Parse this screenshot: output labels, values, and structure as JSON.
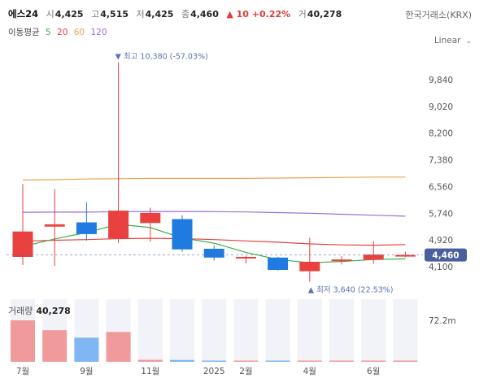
{
  "header": {
    "name": "에스24",
    "open_label": "시",
    "open": "4,425",
    "high_label": "고",
    "high": "4,515",
    "low_label": "저",
    "low": "4,425",
    "close_label": "종",
    "close": "4,460",
    "change": "▲ 10 +0.22%",
    "vol_label": "거",
    "vol": "40,278",
    "exchange": "한국거래소(KRX)",
    "scale_mode": "Linear"
  },
  "ma": {
    "label": "이동평균",
    "ma5": "5",
    "ma20": "20",
    "ma60": "60",
    "ma120": "120"
  },
  "volume_header": {
    "label": "거래량",
    "value": "40,278"
  },
  "colors": {
    "up": "#e8413f",
    "down": "#1f7be0",
    "vol_up": "#f19a9b",
    "vol_down": "#7fb6f3",
    "ma5": "#3fae4a",
    "ma20": "#e8413f",
    "ma60": "#f0a150",
    "ma120": "#9b6ad8",
    "current_badge": "#4a5f9e",
    "annot": "#5a74b3"
  },
  "chart_data": {
    "type": "candlestick",
    "x_tick_labels": [
      "7월",
      "9월",
      "11월",
      "2025",
      "2월",
      "4월",
      "6월"
    ],
    "y_ticks": [
      4100,
      4920,
      5740,
      6560,
      7380,
      8200,
      9020,
      9840
    ],
    "y_tick_labels": [
      "4,100",
      "4,920",
      "5,740",
      "6,560",
      "7,380",
      "8,200",
      "9,020",
      "9,840"
    ],
    "ylim": [
      3500,
      11000
    ],
    "current_price": 4460,
    "current_price_label": "4,460",
    "annotations": {
      "high": "최고 10,380 (-57.03%)",
      "low": "최저 3,640 (22.53%)"
    },
    "candles": [
      {
        "o": 4400,
        "h": 6640,
        "l": 4150,
        "c": 5180
      },
      {
        "o": 5330,
        "h": 6490,
        "l": 4120,
        "c": 5400
      },
      {
        "o": 5460,
        "h": 6080,
        "l": 4900,
        "c": 5100
      },
      {
        "o": 4970,
        "h": 10380,
        "l": 4820,
        "c": 5820
      },
      {
        "o": 5440,
        "h": 5910,
        "l": 4870,
        "c": 5750
      },
      {
        "o": 5560,
        "h": 5680,
        "l": 4560,
        "c": 4630
      },
      {
        "o": 4650,
        "h": 4760,
        "l": 4290,
        "c": 4380
      },
      {
        "o": 4360,
        "h": 4430,
        "l": 4190,
        "c": 4400
      },
      {
        "o": 4380,
        "h": 4400,
        "l": 3980,
        "c": 4000
      },
      {
        "o": 3960,
        "h": 4990,
        "l": 3640,
        "c": 4250
      },
      {
        "o": 4280,
        "h": 4420,
        "l": 4170,
        "c": 4320
      },
      {
        "o": 4310,
        "h": 4880,
        "l": 4190,
        "c": 4470
      },
      {
        "o": 4430,
        "h": 4560,
        "l": 4390,
        "c": 4460
      }
    ],
    "ma5_line": [
      4720,
      4950,
      5150,
      5400,
      5300,
      4980,
      4820,
      4540,
      4320,
      4220,
      4260,
      4320,
      4340
    ],
    "ma20_line": [
      4880,
      4910,
      4930,
      4960,
      4970,
      4960,
      4930,
      4890,
      4850,
      4800,
      4770,
      4760,
      4780
    ],
    "ma60_line": [
      6760,
      6770,
      6790,
      6800,
      6810,
      6810,
      6810,
      6810,
      6820,
      6830,
      6840,
      6850,
      6850
    ],
    "ma120_line": [
      5770,
      5775,
      5775,
      5790,
      5795,
      5795,
      5790,
      5780,
      5760,
      5740,
      5710,
      5680,
      5650
    ],
    "volume": {
      "axis_label": "72.2m",
      "values": [
        72.2,
        55.0,
        42.0,
        52.0,
        3.5,
        3.2,
        0.6,
        0.8,
        0.5,
        1.1,
        0.4,
        0.9,
        0.3
      ],
      "max": 72.2
    }
  }
}
